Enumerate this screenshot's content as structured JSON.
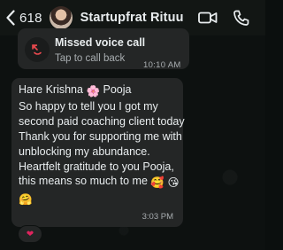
{
  "header": {
    "back_count": "618",
    "contact_name": "Startupfrat Rituu"
  },
  "call": {
    "title": "Missed voice call",
    "subtitle": "Tap to call back",
    "time": "10:10 AM"
  },
  "message": {
    "lines": [
      "Hare Krishna",
      "Pooja",
      "So happy to tell you I got my",
      "second paid coaching client today",
      "Thank you for supporting me with",
      "unblocking my abundance.",
      "Heartfelt gratitude to you Pooja,",
      "this means so much to me"
    ],
    "emoji": {
      "flower": "🌸",
      "love_face": "🥰",
      "kiss_face": "😘",
      "hug_face": "🤗"
    },
    "time": "3:03 PM"
  },
  "reaction": {
    "emoji": "❤"
  }
}
